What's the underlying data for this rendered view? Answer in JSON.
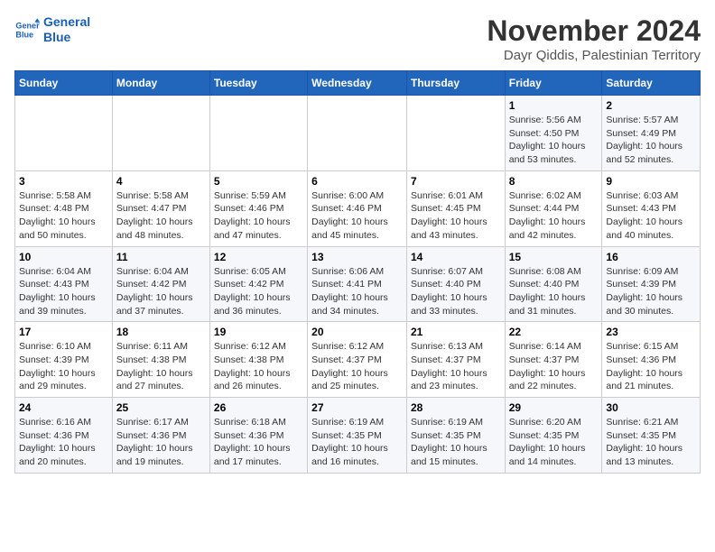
{
  "header": {
    "logo_line1": "General",
    "logo_line2": "Blue",
    "month": "November 2024",
    "location": "Dayr Qiddis, Palestinian Territory"
  },
  "columns": [
    "Sunday",
    "Monday",
    "Tuesday",
    "Wednesday",
    "Thursday",
    "Friday",
    "Saturday"
  ],
  "weeks": [
    [
      {
        "day": "",
        "info": ""
      },
      {
        "day": "",
        "info": ""
      },
      {
        "day": "",
        "info": ""
      },
      {
        "day": "",
        "info": ""
      },
      {
        "day": "",
        "info": ""
      },
      {
        "day": "1",
        "info": "Sunrise: 5:56 AM\nSunset: 4:50 PM\nDaylight: 10 hours and 53 minutes."
      },
      {
        "day": "2",
        "info": "Sunrise: 5:57 AM\nSunset: 4:49 PM\nDaylight: 10 hours and 52 minutes."
      }
    ],
    [
      {
        "day": "3",
        "info": "Sunrise: 5:58 AM\nSunset: 4:48 PM\nDaylight: 10 hours and 50 minutes."
      },
      {
        "day": "4",
        "info": "Sunrise: 5:58 AM\nSunset: 4:47 PM\nDaylight: 10 hours and 48 minutes."
      },
      {
        "day": "5",
        "info": "Sunrise: 5:59 AM\nSunset: 4:46 PM\nDaylight: 10 hours and 47 minutes."
      },
      {
        "day": "6",
        "info": "Sunrise: 6:00 AM\nSunset: 4:46 PM\nDaylight: 10 hours and 45 minutes."
      },
      {
        "day": "7",
        "info": "Sunrise: 6:01 AM\nSunset: 4:45 PM\nDaylight: 10 hours and 43 minutes."
      },
      {
        "day": "8",
        "info": "Sunrise: 6:02 AM\nSunset: 4:44 PM\nDaylight: 10 hours and 42 minutes."
      },
      {
        "day": "9",
        "info": "Sunrise: 6:03 AM\nSunset: 4:43 PM\nDaylight: 10 hours and 40 minutes."
      }
    ],
    [
      {
        "day": "10",
        "info": "Sunrise: 6:04 AM\nSunset: 4:43 PM\nDaylight: 10 hours and 39 minutes."
      },
      {
        "day": "11",
        "info": "Sunrise: 6:04 AM\nSunset: 4:42 PM\nDaylight: 10 hours and 37 minutes."
      },
      {
        "day": "12",
        "info": "Sunrise: 6:05 AM\nSunset: 4:42 PM\nDaylight: 10 hours and 36 minutes."
      },
      {
        "day": "13",
        "info": "Sunrise: 6:06 AM\nSunset: 4:41 PM\nDaylight: 10 hours and 34 minutes."
      },
      {
        "day": "14",
        "info": "Sunrise: 6:07 AM\nSunset: 4:40 PM\nDaylight: 10 hours and 33 minutes."
      },
      {
        "day": "15",
        "info": "Sunrise: 6:08 AM\nSunset: 4:40 PM\nDaylight: 10 hours and 31 minutes."
      },
      {
        "day": "16",
        "info": "Sunrise: 6:09 AM\nSunset: 4:39 PM\nDaylight: 10 hours and 30 minutes."
      }
    ],
    [
      {
        "day": "17",
        "info": "Sunrise: 6:10 AM\nSunset: 4:39 PM\nDaylight: 10 hours and 29 minutes."
      },
      {
        "day": "18",
        "info": "Sunrise: 6:11 AM\nSunset: 4:38 PM\nDaylight: 10 hours and 27 minutes."
      },
      {
        "day": "19",
        "info": "Sunrise: 6:12 AM\nSunset: 4:38 PM\nDaylight: 10 hours and 26 minutes."
      },
      {
        "day": "20",
        "info": "Sunrise: 6:12 AM\nSunset: 4:37 PM\nDaylight: 10 hours and 25 minutes."
      },
      {
        "day": "21",
        "info": "Sunrise: 6:13 AM\nSunset: 4:37 PM\nDaylight: 10 hours and 23 minutes."
      },
      {
        "day": "22",
        "info": "Sunrise: 6:14 AM\nSunset: 4:37 PM\nDaylight: 10 hours and 22 minutes."
      },
      {
        "day": "23",
        "info": "Sunrise: 6:15 AM\nSunset: 4:36 PM\nDaylight: 10 hours and 21 minutes."
      }
    ],
    [
      {
        "day": "24",
        "info": "Sunrise: 6:16 AM\nSunset: 4:36 PM\nDaylight: 10 hours and 20 minutes."
      },
      {
        "day": "25",
        "info": "Sunrise: 6:17 AM\nSunset: 4:36 PM\nDaylight: 10 hours and 19 minutes."
      },
      {
        "day": "26",
        "info": "Sunrise: 6:18 AM\nSunset: 4:36 PM\nDaylight: 10 hours and 17 minutes."
      },
      {
        "day": "27",
        "info": "Sunrise: 6:19 AM\nSunset: 4:35 PM\nDaylight: 10 hours and 16 minutes."
      },
      {
        "day": "28",
        "info": "Sunrise: 6:19 AM\nSunset: 4:35 PM\nDaylight: 10 hours and 15 minutes."
      },
      {
        "day": "29",
        "info": "Sunrise: 6:20 AM\nSunset: 4:35 PM\nDaylight: 10 hours and 14 minutes."
      },
      {
        "day": "30",
        "info": "Sunrise: 6:21 AM\nSunset: 4:35 PM\nDaylight: 10 hours and 13 minutes."
      }
    ]
  ]
}
